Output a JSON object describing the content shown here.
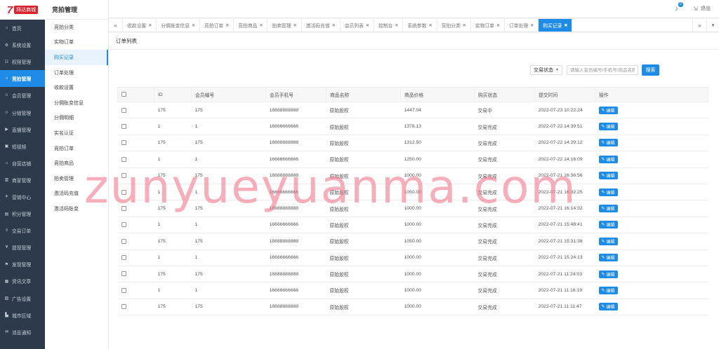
{
  "app": {
    "logo_mark": "7",
    "logo_text": "拜达商城"
  },
  "main_nav": [
    {
      "icon": "home-icon",
      "glyph": "⌂",
      "label": "首页"
    },
    {
      "icon": "gear-icon",
      "glyph": "⚙",
      "label": "系统设置"
    },
    {
      "icon": "sitemap-icon",
      "glyph": "☷",
      "label": "权限管理"
    },
    {
      "icon": "home-icon",
      "glyph": "⌂",
      "label": "竞拍管理",
      "active": true
    },
    {
      "icon": "users-icon",
      "glyph": "☺",
      "label": "会员管理"
    },
    {
      "icon": "users-icon",
      "glyph": "☺",
      "label": "分销管理"
    },
    {
      "icon": "video-icon",
      "glyph": "▶",
      "label": "直播管理"
    },
    {
      "icon": "film-icon",
      "glyph": "▣",
      "label": "短视频"
    },
    {
      "icon": "store-icon",
      "glyph": "⌂",
      "label": "自营店铺"
    },
    {
      "icon": "bank-icon",
      "glyph": "▥",
      "label": "商家管理"
    },
    {
      "icon": "rocket-icon",
      "glyph": "✈",
      "label": "营销中心"
    },
    {
      "icon": "points-icon",
      "glyph": "▤",
      "label": "积分管理"
    },
    {
      "icon": "order-icon",
      "glyph": "≡",
      "label": "交易订单"
    },
    {
      "icon": "yen-icon",
      "glyph": "¥",
      "label": "提现管理"
    },
    {
      "icon": "flag-icon",
      "glyph": "⚑",
      "label": "发现管理"
    },
    {
      "icon": "news-icon",
      "glyph": "▦",
      "label": "资讯文章"
    },
    {
      "icon": "image-icon",
      "glyph": "▨",
      "label": "广告设置"
    },
    {
      "icon": "building-icon",
      "glyph": "▙",
      "label": "城市区域"
    },
    {
      "icon": "chat-icon",
      "glyph": "✉",
      "label": "消息通知"
    }
  ],
  "sub_nav": {
    "title": "竞拍管理",
    "items": [
      {
        "label": "竞拍分类"
      },
      {
        "label": "实物订单"
      },
      {
        "label": "购买记录",
        "active": true
      },
      {
        "label": "订单处理"
      },
      {
        "label": "收款设置"
      },
      {
        "label": "分佣账变信息"
      },
      {
        "label": "分佣明细"
      },
      {
        "label": "实名认证"
      },
      {
        "label": "竞拍订单"
      },
      {
        "label": "竞拍商品"
      },
      {
        "label": "拍卖管理"
      },
      {
        "label": "激活码充值"
      },
      {
        "label": "激活码账变"
      }
    ]
  },
  "header": {
    "badge_count": "0",
    "logout_label": "退出"
  },
  "tabs": [
    {
      "label": "收款设置"
    },
    {
      "label": "分佣账变信息"
    },
    {
      "label": "竞拍订单"
    },
    {
      "label": "竞拍商品"
    },
    {
      "label": "拍卖管理"
    },
    {
      "label": "激活码充值"
    },
    {
      "label": "会员列表"
    },
    {
      "label": "控制台"
    },
    {
      "label": "系统参数"
    },
    {
      "label": "竞拍分类"
    },
    {
      "label": "实物订单"
    },
    {
      "label": "订单处理"
    },
    {
      "label": "购买记录",
      "active": true
    }
  ],
  "panel": {
    "title": "订单列表",
    "status_select": "交易状态",
    "search_placeholder": "请输入会员编号/手机号/商品名称",
    "search_button": "搜索",
    "columns": [
      "ID",
      "会员编号",
      "会员手机号",
      "商品名称",
      "商品价格",
      "购买状态",
      "提交时间",
      "操作"
    ],
    "edit_label": "编辑",
    "rows": [
      [
        "175",
        "175",
        "18888888888",
        "原始股权",
        "1447.04",
        "交易中",
        "2022-07-23 10:22:24"
      ],
      [
        "1",
        "1",
        "16666666666",
        "原始股权",
        "1378.13",
        "交易完成",
        "2022-07-22 14:39:51"
      ],
      [
        "175",
        "175",
        "18888888888",
        "原始股权",
        "1312.50",
        "交易完成",
        "2022-07-22 14:29:12"
      ],
      [
        "1",
        "1",
        "16666666666",
        "原始股权",
        "1250.00",
        "交易完成",
        "2022-07-22 14:16:09"
      ],
      [
        "175",
        "175",
        "18888888888",
        "原始股权",
        "1000.00",
        "交易完成",
        "2022-07-21 16:36:56"
      ],
      [
        "1",
        "1",
        "16666666666",
        "原始股权",
        "1050.00",
        "交易完成",
        "2022-07-21 16:32:25"
      ],
      [
        "175",
        "175",
        "18888888888",
        "原始股权",
        "1000.00",
        "交易完成",
        "2022-07-21 16:14:32"
      ],
      [
        "1",
        "1",
        "16666666666",
        "原始股权",
        "1000.00",
        "交易完成",
        "2022-07-21 15:48:41"
      ],
      [
        "175",
        "175",
        "18888888888",
        "原始股权",
        "1050.00",
        "交易完成",
        "2022-07-21 15:31:38"
      ],
      [
        "1",
        "1",
        "16666666666",
        "原始股权",
        "1000.00",
        "交易完成",
        "2022-07-21 15:24:13"
      ],
      [
        "175",
        "175",
        "18888888888",
        "原始股权",
        "1000.00",
        "交易完成",
        "2022-07-21 11:24:03"
      ],
      [
        "1",
        "1",
        "16666666666",
        "原始股权",
        "1000.00",
        "交易完成",
        "2022-07-21 11:16:19"
      ],
      [
        "175",
        "175",
        "18888888888",
        "原始股权",
        "1000.00",
        "交易完成",
        "2022-07-21 11:11:47"
      ]
    ]
  },
  "watermark": "zunyueyuanma.com",
  "colors": {
    "accent": "#1e8be6",
    "sidebar": "#2c3a4b",
    "brand_red": "#d9232d"
  }
}
